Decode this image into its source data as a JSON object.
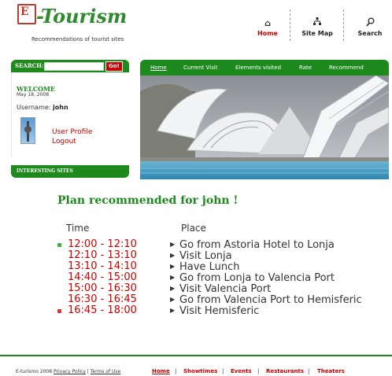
{
  "header": {
    "logo_text": "-Tourism",
    "logo_mark": "E",
    "subtitle": "Recommendations of tourist sites",
    "nav": [
      {
        "label": "Home",
        "icon": "home-icon"
      },
      {
        "label": "Site Map",
        "icon": "sitemap-icon"
      },
      {
        "label": "Search",
        "icon": "magnifier-icon"
      }
    ]
  },
  "sidebar": {
    "search_label": "SEARCH:",
    "search_value": "",
    "go_label": "Go!",
    "welcome_title": "WELCOME",
    "date": "May 18, 2008",
    "username_label": "Username:",
    "username": "john",
    "links": [
      "User Profile",
      "Logout"
    ],
    "interesting_label": "INTERESTING SITES"
  },
  "main_nav": [
    "Home",
    "Current Visit",
    "Elements visited",
    "Rate",
    "Recommend"
  ],
  "plan": {
    "title": "Plan recommended for john !",
    "time_header": "Time",
    "place_header": "Place",
    "rows": [
      {
        "time": "12:00 - 12:10",
        "place": "Go from Astoria Hotel to Lonja"
      },
      {
        "time": "12:10 - 13:10",
        "place": "Visit Lonja"
      },
      {
        "time": "13:10 - 14:10",
        "place": "Have Lunch"
      },
      {
        "time": "14:40 - 15:00",
        "place": "Go from Lonja to Valencia Port"
      },
      {
        "time": "15:00 - 16:30",
        "place": "Visit Valencia Port"
      },
      {
        "time": "16:30 - 16:45",
        "place": "Go from Valencia Port to Hemisferic"
      },
      {
        "time": "16:45 - 18:00",
        "place": "Visit Hemisferic"
      }
    ]
  },
  "footer": {
    "copyright": "E-turismo 2008",
    "privacy": "Privacy Policy",
    "terms": "Terms of Use",
    "links": [
      "Home",
      "Showtimes",
      "Events",
      "Restaurants",
      "Theaters"
    ]
  },
  "colors": {
    "accent_green": "#1e8a1e",
    "accent_red": "#cc0000"
  }
}
